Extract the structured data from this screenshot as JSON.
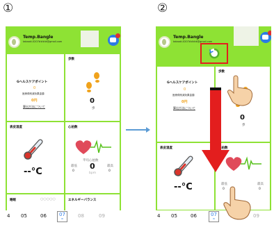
{
  "steps": {
    "one": "①",
    "two": "②"
  },
  "app": {
    "user_name": "Temp.Bangle",
    "user_email": "takaaki.0207####@gmail.com"
  },
  "cards": {
    "health_point": {
      "title": "Gヘルスケアポイント",
      "points": "0",
      "medical_label": "医療費削減効果金額",
      "medical_value": "0円",
      "link": "算出方法について"
    },
    "steps": {
      "title": "歩数",
      "value": "0",
      "unit": "歩"
    },
    "temperature": {
      "title": "表皮温度",
      "value": "--°C"
    },
    "heart_rate": {
      "title": "心拍数",
      "avg_label": "平均心拍数",
      "min_label": "最低",
      "avg_value": "0",
      "max_label": "最高",
      "min_value": "0",
      "unit": "bpm",
      "max_value": "0"
    },
    "sleep": {
      "title": "睡眠"
    },
    "energy": {
      "title": "エネルギーバランス"
    }
  },
  "dates": {
    "items": [
      "4",
      "05",
      "06",
      "07",
      "08",
      "09"
    ],
    "selected_sub": "W"
  },
  "colors": {
    "header_green": "#8ee234",
    "accent_orange": "#f0a21b",
    "blue": "#2c7be5",
    "red_arrow": "#e31e1e"
  }
}
